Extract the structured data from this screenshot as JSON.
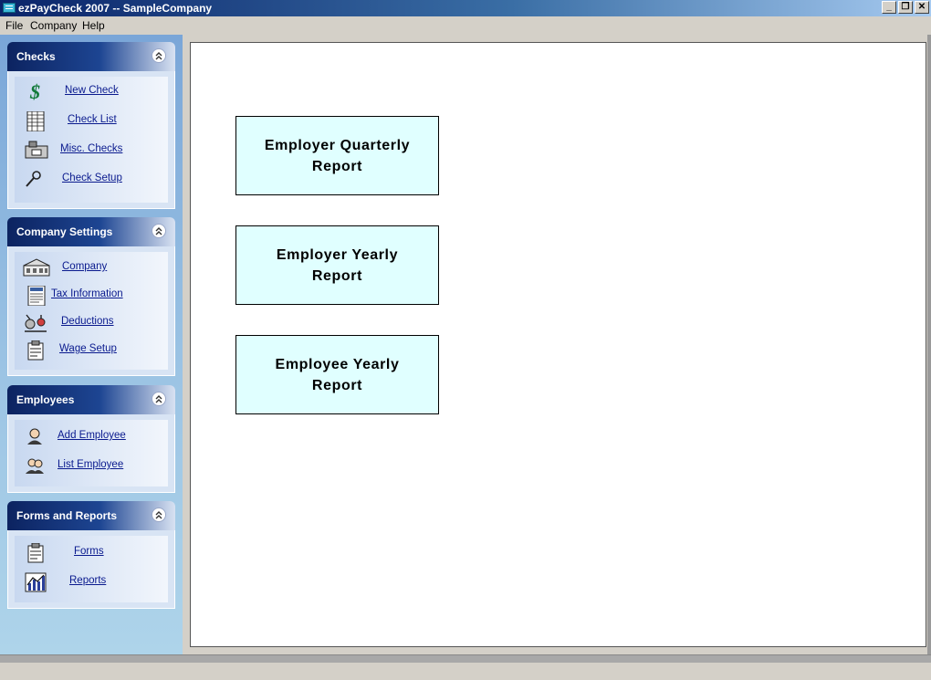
{
  "window": {
    "title": "ezPayCheck 2007 -- SampleCompany",
    "controls": {
      "minimize": "_",
      "restore": "❐",
      "close": "✕"
    }
  },
  "menu": {
    "items": [
      "File",
      "Company",
      "Help"
    ]
  },
  "sidebar": {
    "panels": [
      {
        "title": "Checks",
        "items": [
          {
            "label": "New Check",
            "icon": "dollar-icon"
          },
          {
            "label": "Check List",
            "icon": "ledger-icon"
          },
          {
            "label": "Misc. Checks",
            "icon": "printer-icon"
          },
          {
            "label": "Check Setup",
            "icon": "wrench-icon"
          }
        ]
      },
      {
        "title": "Company Settings",
        "items": [
          {
            "label": "Company",
            "icon": "building-icon"
          },
          {
            "label": "Tax Information",
            "icon": "tax-form-icon"
          },
          {
            "label": "Deductions",
            "icon": "deductions-icon"
          },
          {
            "label": "Wage Setup",
            "icon": "clipboard-icon"
          }
        ]
      },
      {
        "title": "Employees",
        "items": [
          {
            "label": "Add Employee",
            "icon": "person-icon"
          },
          {
            "label": "List Employee",
            "icon": "people-icon"
          }
        ]
      },
      {
        "title": "Forms and Reports",
        "items": [
          {
            "label": "Forms",
            "icon": "form-icon"
          },
          {
            "label": "Reports",
            "icon": "chart-icon"
          }
        ]
      }
    ]
  },
  "main": {
    "reports": [
      {
        "line1": "Employer Quarterly",
        "line2": "Report"
      },
      {
        "line1": "Employer Yearly",
        "line2": "Report"
      },
      {
        "line1": "Employee Yearly",
        "line2": "Report"
      }
    ]
  },
  "colors": {
    "panel_header": "#0c2360",
    "link": "#0a1a8e",
    "report_button_bg": "#e0ffff",
    "sidebar_bg": "#9cc4e4"
  }
}
